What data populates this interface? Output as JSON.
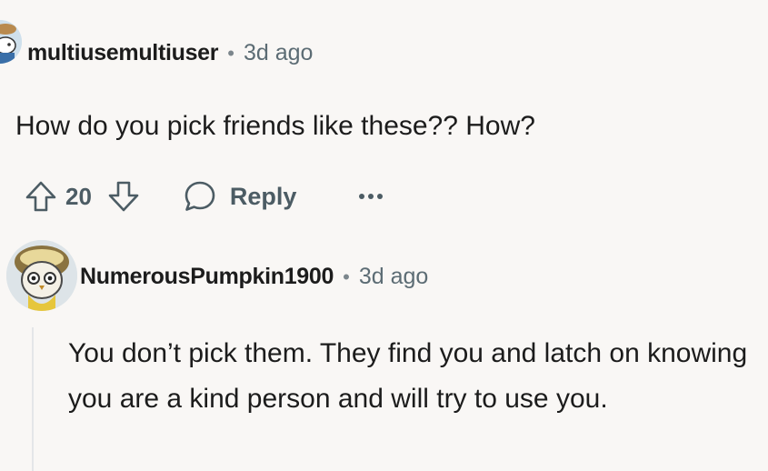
{
  "comment_1": {
    "username": "multiusemultiuser",
    "separator": "•",
    "time": "3d ago",
    "body": "How do you pick friends like these?? How?",
    "score": "20",
    "reply_label": "Reply",
    "more_label": "•••"
  },
  "comment_2": {
    "username": "NumerousPumpkin1900",
    "separator": "•",
    "time": "3d ago",
    "body": "You don’t pick them. They find you and latch on knowing you are a kind person and will try to use you."
  },
  "icons": {
    "upvote": "arrow-up-outline-icon",
    "downvote": "arrow-down-outline-icon",
    "reply": "speech-bubble-icon",
    "more": "three-dots-icon"
  },
  "colors": {
    "background": "#f9f7f5",
    "text": "#1c1c1c",
    "meta": "#5c6c74",
    "thread_line": "#e4e6e8"
  }
}
